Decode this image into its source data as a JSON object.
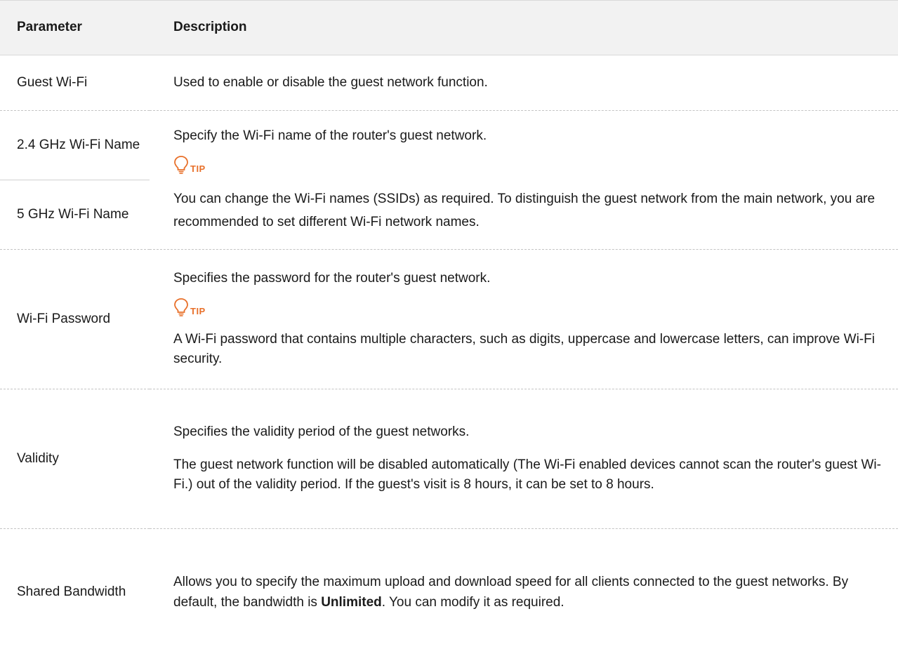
{
  "header": {
    "param": "Parameter",
    "desc": "Description"
  },
  "rows": {
    "guest": {
      "param": "Guest Wi-Fi",
      "desc": "Used to enable or disable the guest network function."
    },
    "name": {
      "param_24": "2.4 GHz Wi-Fi Name",
      "param_5": "5 GHz Wi-Fi Name",
      "desc": "Specify the Wi-Fi name of the router's guest network.",
      "tip_label": "TIP",
      "tip": "You can change the Wi-Fi names (SSIDs) as required. To distinguish the guest network from the main network, you are recommended to set different Wi-Fi network names."
    },
    "password": {
      "param": "Wi-Fi Password",
      "desc": "Specifies the password for the router's guest network.",
      "tip_label": "TIP",
      "tip": "A Wi-Fi password that contains multiple characters, such as digits, uppercase and lowercase letters, can improve Wi-Fi security."
    },
    "validity": {
      "param": "Validity",
      "desc": "Specifies the validity period of the guest networks.",
      "desc2": "The guest network function will be disabled automatically (The Wi-Fi enabled devices cannot scan the router's guest Wi-Fi.) out of the validity period. If the guest's visit is 8 hours, it can be set to 8 hours."
    },
    "bandwidth": {
      "param": "Shared Bandwidth",
      "desc_pre": "Allows you to specify the maximum upload and download speed for all clients connected to the guest networks. By default, the bandwidth is ",
      "desc_bold": "Unlimited",
      "desc_post": ". You can modify it as required."
    }
  },
  "colors": {
    "tip": "#e8702a",
    "header_bg": "#f2f2f2"
  },
  "icons": {
    "tip": "lightbulb-icon"
  }
}
